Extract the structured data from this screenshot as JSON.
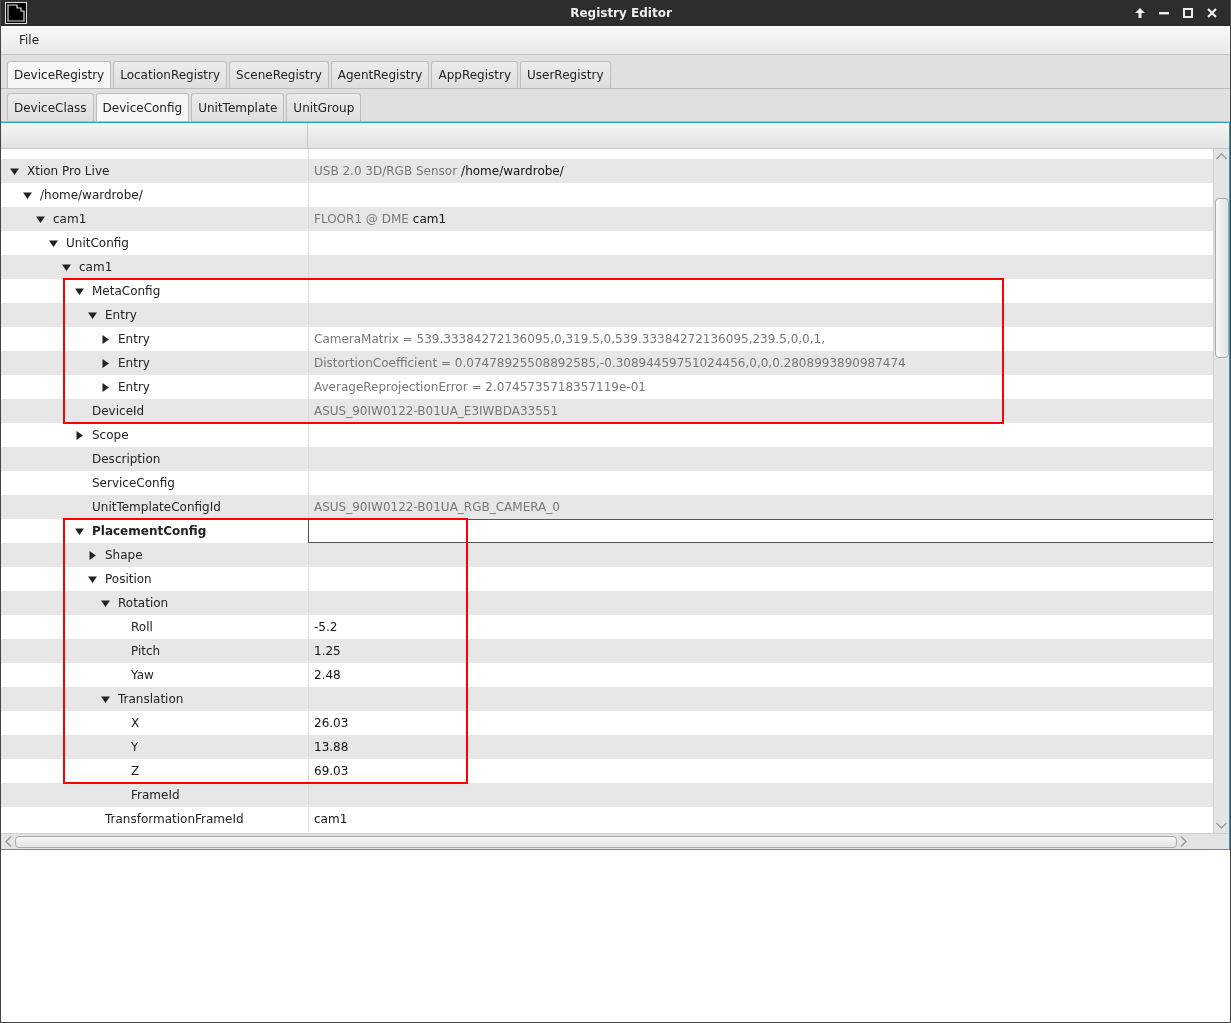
{
  "window": {
    "title": "Registry Editor"
  },
  "menu": [
    {
      "label": "File"
    }
  ],
  "tabs": [
    {
      "label": "DeviceRegistry",
      "selected": true
    },
    {
      "label": "LocationRegistry",
      "selected": false
    },
    {
      "label": "SceneRegistry",
      "selected": false
    },
    {
      "label": "AgentRegistry",
      "selected": false
    },
    {
      "label": "AppRegistry",
      "selected": false
    },
    {
      "label": "UserRegistry",
      "selected": false
    }
  ],
  "subtabs": [
    {
      "label": "DeviceClass",
      "selected": false
    },
    {
      "label": "DeviceConfig",
      "selected": true
    },
    {
      "label": "UnitTemplate",
      "selected": false
    },
    {
      "label": "UnitGroup",
      "selected": false
    }
  ],
  "tree": [
    {
      "label": "Xtion Pro Live",
      "expanded": true,
      "selected": false,
      "value": [
        {
          "text": "USB 2.0 3D/RGB Sensor",
          "muted": true
        },
        {
          "text": "/home/wardrobe/",
          "muted": false
        }
      ],
      "children": [
        {
          "label": "/home/wardrobe/",
          "expanded": true,
          "selected": false,
          "children": [
            {
              "label": "cam1",
              "expanded": true,
              "selected": false,
              "value": [
                {
                  "text": "FLOOR1 @ DME",
                  "muted": true
                },
                {
                  "text": "cam1",
                  "muted": false
                }
              ],
              "children": [
                {
                  "label": "UnitConfig",
                  "expanded": true,
                  "selected": false,
                  "children": [
                    {
                      "label": "cam1",
                      "expanded": true,
                      "selected": false,
                      "children": [
                        {
                          "label": "MetaConfig",
                          "expanded": true,
                          "selected": false,
                          "highlighted": true,
                          "children": [
                            {
                              "label": "Entry",
                              "expanded": true,
                              "selected": false,
                              "highlighted": true,
                              "children": [
                                {
                                  "label": "Entry",
                                  "expanded": false,
                                  "selected": false,
                                  "highlighted": true,
                                  "value": [
                                    {
                                      "text": "CameraMatrix = 539.33384272136095,0,319.5,0,539.33384272136095,239.5,0,0,1,",
                                      "muted": true
                                    }
                                  ]
                                },
                                {
                                  "label": "Entry",
                                  "expanded": false,
                                  "selected": false,
                                  "highlighted": true,
                                  "value": [
                                    {
                                      "text": "DistortionCoefficient = 0.07478925508892585,-0.30894459751024456,0,0,0.2808993890987474",
                                      "muted": true
                                    }
                                  ]
                                },
                                {
                                  "label": "Entry",
                                  "expanded": false,
                                  "selected": false,
                                  "highlighted": true,
                                  "value": [
                                    {
                                      "text": "AverageReprojectionError = 2.0745735718357119e-01",
                                      "muted": true
                                    }
                                  ]
                                }
                              ]
                            }
                          ]
                        },
                        {
                          "label": "DeviceId",
                          "selected": false,
                          "highlighted": true,
                          "value": [
                            {
                              "text": "ASUS_90IW0122-B01UA_E3IWBDA33551",
                              "muted": true
                            }
                          ]
                        },
                        {
                          "label": "Scope",
                          "expanded": false,
                          "selected": false
                        },
                        {
                          "label": "Description",
                          "selected": false
                        },
                        {
                          "label": "ServiceConfig",
                          "selected": false
                        },
                        {
                          "label": "UnitTemplateConfigId",
                          "selected": false,
                          "value": [
                            {
                              "text": "ASUS_90IW0122-B01UA_RGB_CAMERA_0",
                              "muted": true
                            }
                          ]
                        },
                        {
                          "label": "PlacementConfig",
                          "expanded": true,
                          "selected": true,
                          "highlighted": true,
                          "children": [
                            {
                              "label": "Shape",
                              "expanded": false,
                              "selected": false,
                              "highlighted": true
                            },
                            {
                              "label": "Position",
                              "expanded": true,
                              "selected": false,
                              "highlighted": true,
                              "children": [
                                {
                                  "label": "Rotation",
                                  "expanded": true,
                                  "selected": false,
                                  "highlighted": true,
                                  "children": [
                                    {
                                      "label": "Roll",
                                      "selected": false,
                                      "highlighted": true,
                                      "value": [
                                        {
                                          "text": "-5.2",
                                          "muted": false
                                        }
                                      ]
                                    },
                                    {
                                      "label": "Pitch",
                                      "selected": false,
                                      "highlighted": true,
                                      "value": [
                                        {
                                          "text": "1.25",
                                          "muted": false
                                        }
                                      ]
                                    },
                                    {
                                      "label": "Yaw",
                                      "selected": false,
                                      "highlighted": true,
                                      "value": [
                                        {
                                          "text": "2.48",
                                          "muted": false
                                        }
                                      ]
                                    }
                                  ]
                                },
                                {
                                  "label": "Translation",
                                  "expanded": true,
                                  "selected": false,
                                  "highlighted": true,
                                  "children": [
                                    {
                                      "label": "X",
                                      "selected": false,
                                      "highlighted": true,
                                      "value": [
                                        {
                                          "text": "26.03",
                                          "muted": false
                                        }
                                      ]
                                    },
                                    {
                                      "label": "Y",
                                      "selected": false,
                                      "highlighted": true,
                                      "value": [
                                        {
                                          "text": "13.88",
                                          "muted": false
                                        }
                                      ]
                                    },
                                    {
                                      "label": "Z",
                                      "selected": false,
                                      "highlighted": true,
                                      "value": [
                                        {
                                          "text": "69.03",
                                          "muted": false
                                        }
                                      ]
                                    },
                                    {
                                      "label": "FrameId",
                                      "selected": false
                                    }
                                  ]
                                }
                              ]
                            },
                            {
                              "label": "TransformationFrameId",
                              "selected": false,
                              "value": [
                                {
                                  "text": "cam1",
                                  "muted": false
                                }
                              ]
                            }
                          ]
                        }
                      ]
                    }
                  ]
                }
              ]
            }
          ]
        }
      ]
    }
  ]
}
